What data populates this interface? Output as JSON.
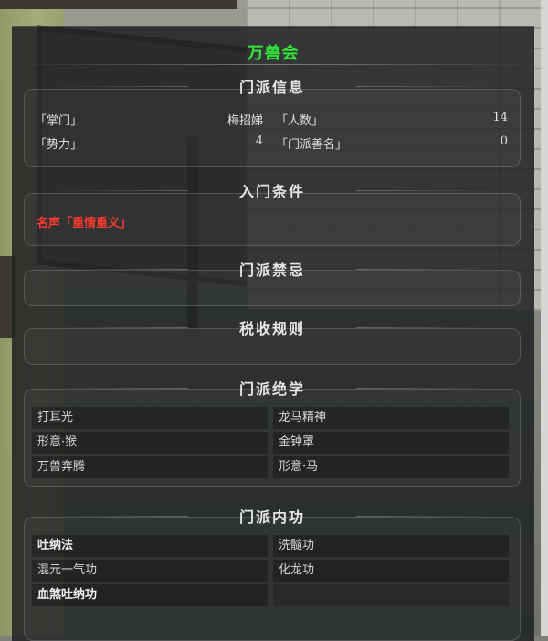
{
  "sect_name": "万兽会",
  "sections": {
    "info": {
      "title": "门派信息",
      "leader_label": "「掌门」",
      "leader_value": "梅招娣",
      "members_label": "「人数」",
      "members_value": "14",
      "power_label": "「势力」",
      "power_value": "4",
      "reputation_label": "「门派善名」",
      "reputation_value": "0"
    },
    "entry": {
      "title": "入门条件",
      "requirement": "名声「重情重义」",
      "requirement_color": "#ff3b2f"
    },
    "taboo": {
      "title": "门派禁忌"
    },
    "tax": {
      "title": "税收规则"
    },
    "skills": {
      "title": "门派绝学",
      "items": [
        "打耳光",
        "龙马精神",
        "形意·猴",
        "金钟罩",
        "万兽奔腾",
        "形意·马"
      ]
    },
    "inner": {
      "title": "门派内功",
      "items": [
        "吐纳法",
        "洗髓功",
        "混元一气功",
        "化龙功",
        "血煞吐纳功"
      ]
    }
  },
  "colors": {
    "title": "#33e43a",
    "panel": "rgba(32,34,37,0.87)"
  }
}
